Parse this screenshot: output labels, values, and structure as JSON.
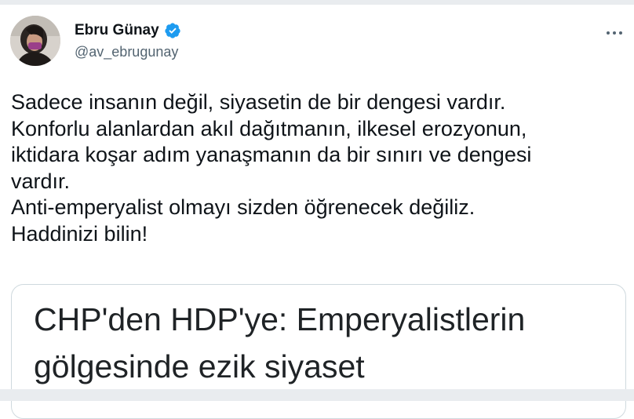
{
  "tweet": {
    "author": {
      "name": "Ebru Günay",
      "handle": "@av_ebrugunay",
      "verified": true,
      "verified_color": "#1d9bf0"
    },
    "text_lines": [
      "Sadece insanın değil, siyasetin de bir dengesi vardır.",
      "Konforlu alanlardan akıl dağıtmanın, ilkesel erozyonun,",
      "iktidara koşar adım yanaşmanın da bir sınırı ve dengesi",
      "vardır.",
      "Anti-emperyalist olmayı sizden öğrenecek değiliz.",
      "Haddinizi bilin!"
    ],
    "card": {
      "headline_lines": [
        "CHP'den HDP'ye: Emperyalistlerin",
        "gölgesinde ezik siyaset"
      ]
    }
  },
  "icons": {
    "verified": "verified-badge-icon",
    "more": "more-options-icon"
  },
  "colors": {
    "text": "#0f1419",
    "secondary": "#536471",
    "border": "#cfd9de",
    "frame": "#e9ecef"
  }
}
